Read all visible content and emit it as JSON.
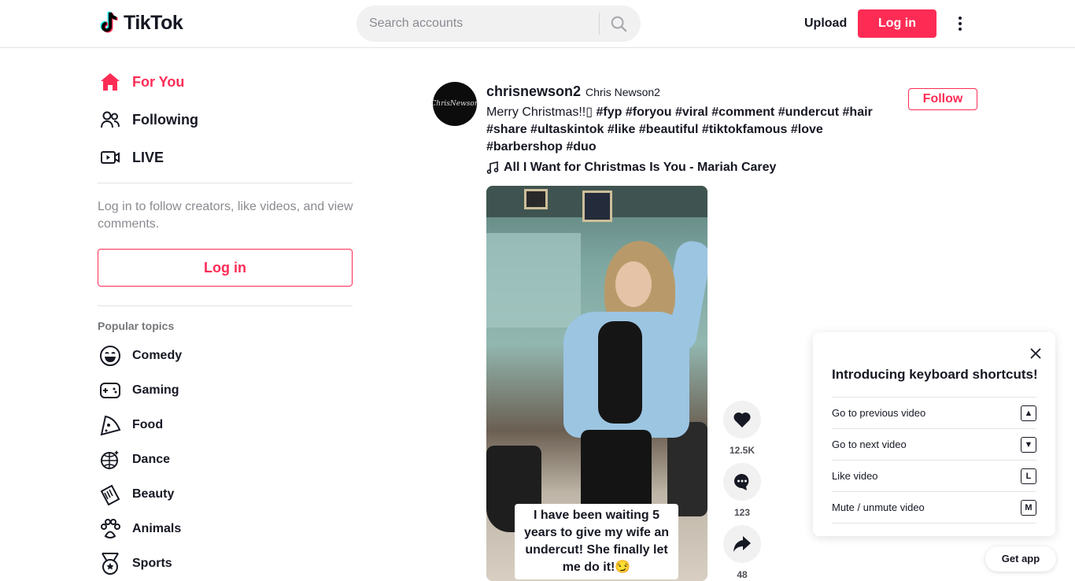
{
  "header": {
    "logo_text": "TikTok",
    "search_placeholder": "Search accounts",
    "upload_label": "Upload",
    "login_label": "Log in"
  },
  "sidebar": {
    "nav": [
      {
        "label": "For You",
        "icon": "home-icon",
        "active": true
      },
      {
        "label": "Following",
        "icon": "people-icon"
      },
      {
        "label": "LIVE",
        "icon": "live-icon"
      }
    ],
    "login_hint": "Log in to follow creators, like videos, and view comments.",
    "login_button": "Log in",
    "topics_title": "Popular topics",
    "topics": [
      {
        "label": "Comedy",
        "icon": "comedy-icon"
      },
      {
        "label": "Gaming",
        "icon": "gaming-icon"
      },
      {
        "label": "Food",
        "icon": "food-icon"
      },
      {
        "label": "Dance",
        "icon": "dance-icon"
      },
      {
        "label": "Beauty",
        "icon": "beauty-icon"
      },
      {
        "label": "Animals",
        "icon": "animals-icon"
      },
      {
        "label": "Sports",
        "icon": "sports-icon"
      }
    ]
  },
  "post": {
    "author_id": "chrisnewson2",
    "author_nick": "Chris Newson2",
    "avatar_text": "ChrisNewson",
    "caption_text": "Merry Christmas!!▯ ",
    "hashtags": [
      "#fyp",
      "#foryou",
      "#viral",
      "#comment",
      "#undercut",
      "#hair",
      "#share",
      "#ultaskintok",
      "#like",
      "#beautiful",
      "#tiktokfamous",
      "#love",
      "#barbershop",
      "#duo"
    ],
    "music": "All I Want for Christmas Is You - Mariah Carey",
    "follow_label": "Follow",
    "video_caption": "I have been waiting 5 years to give my wife an undercut! She finally let me do it!😏",
    "likes": "12.5K",
    "comments": "123",
    "shares": "48"
  },
  "shortcuts": {
    "title": "Introducing keyboard shortcuts!",
    "items": [
      {
        "label": "Go to previous video",
        "key": "▲"
      },
      {
        "label": "Go to next video",
        "key": "▼"
      },
      {
        "label": "Like video",
        "key": "L"
      },
      {
        "label": "Mute / unmute video",
        "key": "M"
      }
    ]
  },
  "get_app": "Get app",
  "colors": {
    "brand": "#fe2c55",
    "text": "#161823",
    "muted": "#8a8b91"
  }
}
